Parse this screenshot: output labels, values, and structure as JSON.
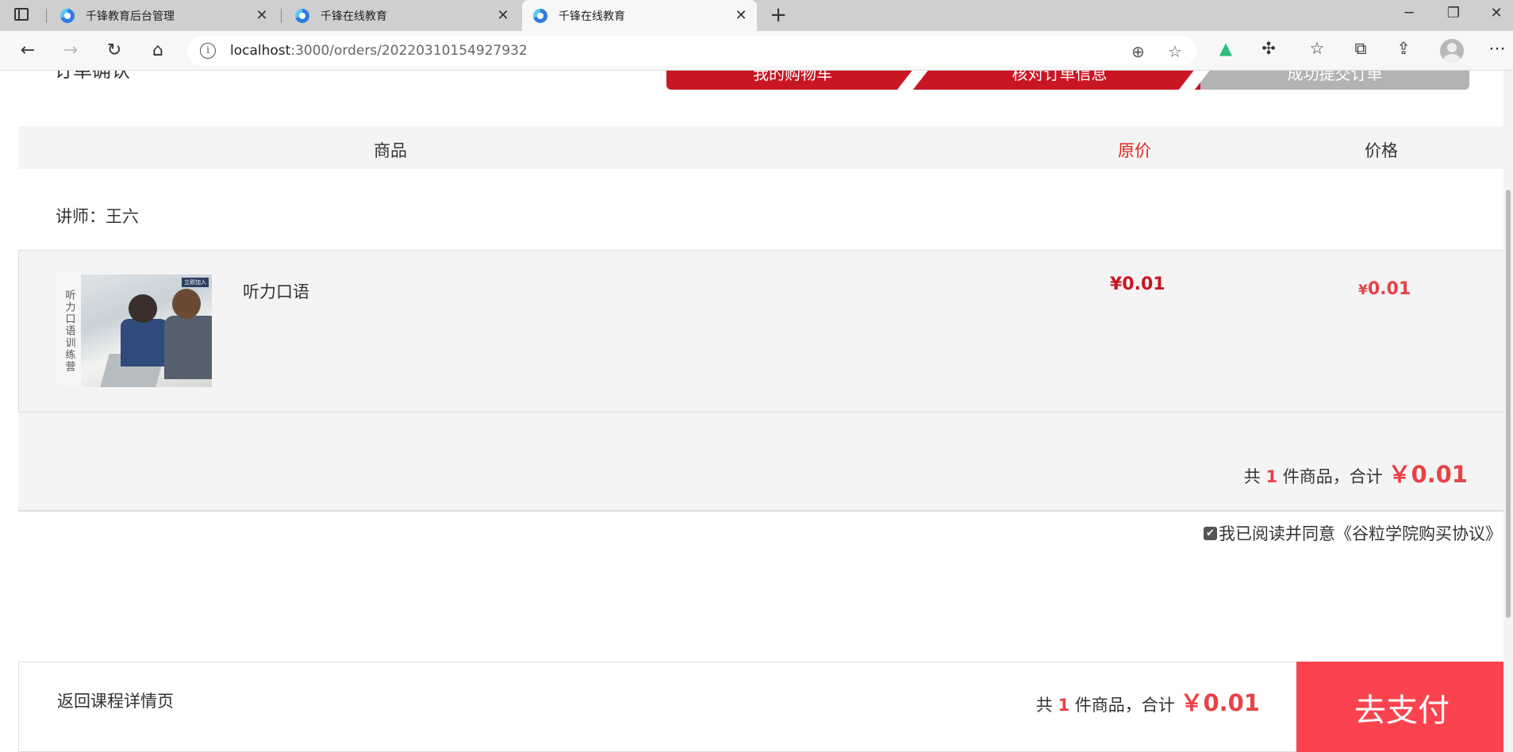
{
  "browser": {
    "tabs": [
      {
        "title": "千锋教育后台管理",
        "close": "✕"
      },
      {
        "title": "千锋在线教育",
        "close": "✕"
      },
      {
        "title": "千锋在线教育",
        "close": "✕"
      }
    ],
    "new_tab": "+",
    "url_host": "localhost",
    "url_path": ":3000/orders/20220310154927932",
    "url_info": "i"
  },
  "page": {
    "title": "订单确认",
    "steps": [
      "我的购物车",
      "核对订单信息",
      "成功提交订单"
    ],
    "table_headers": {
      "product": "商品",
      "original_price": "原价",
      "price": "价格"
    },
    "teacher": "讲师：王六",
    "item": {
      "name": "听力口语",
      "thumb_text": "听力口语训练营",
      "thumb_badge": "立即加入",
      "original_price": "¥0.01",
      "price_symbol": "¥",
      "price_value": "0.01"
    },
    "summary": {
      "prefix": "共 ",
      "count": "1",
      "middle": " 件商品，合计 ",
      "amount": "￥0.01"
    },
    "agreement": "我已阅读并同意《谷粒学院购买协议》",
    "footer": {
      "back": "返回课程详情页",
      "prefix": "共 ",
      "count": "1",
      "middle": " 件商品，合计 ",
      "amount": "￥0.01",
      "pay": "去支付"
    }
  },
  "colors": {
    "accent_red": "#c81623",
    "price_red": "#e64346",
    "pay_button": "#fb4350",
    "step_inactive": "#b3b3b3"
  }
}
